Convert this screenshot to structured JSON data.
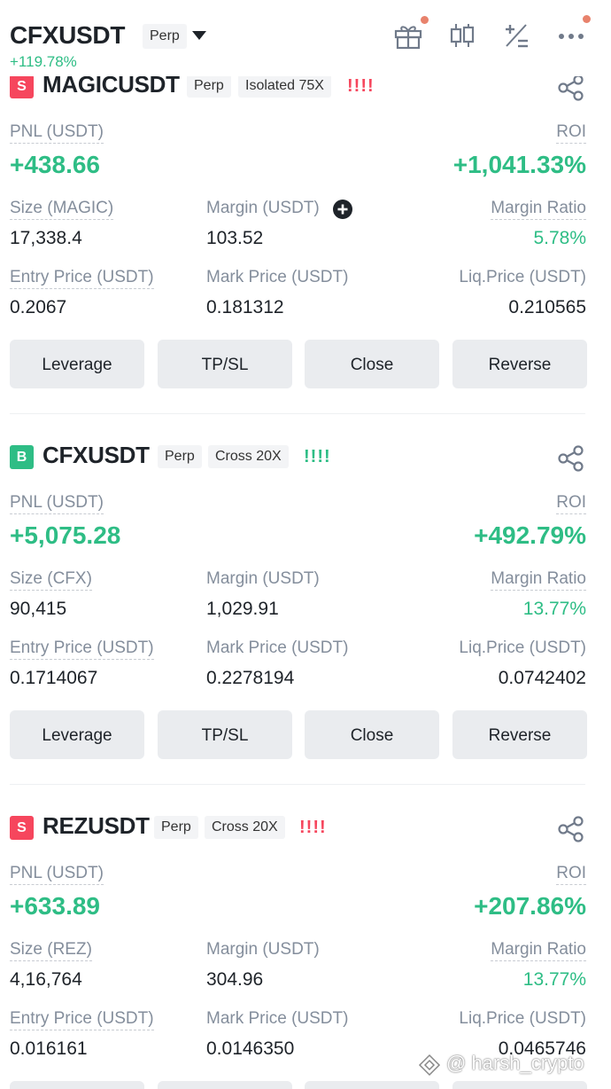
{
  "header": {
    "symbol": "CFXUSDT",
    "type": "Perp",
    "change": "+119.78%",
    "icons": [
      "gift-icon",
      "candlestick-icon",
      "calculator-icon",
      "more-icon"
    ]
  },
  "labels": {
    "pnl": "PNL (USDT)",
    "roi": "ROI",
    "margin": "Margin (USDT)",
    "margin_ratio": "Margin Ratio",
    "entry_price": "Entry Price (USDT)",
    "mark_price": "Mark Price (USDT)",
    "liq_price": "Liq.Price (USDT)"
  },
  "buttons": {
    "leverage": "Leverage",
    "tpsl": "TP/SL",
    "close": "Close",
    "reverse": "Reverse"
  },
  "positions": [
    {
      "side_letter": "S",
      "side": "short",
      "symbol": "MAGICUSDT",
      "type": "Perp",
      "margin_mode": "Isolated 75X",
      "risk_bars": "!!!!",
      "pnl": "+438.66",
      "roi": "+1,041.33%",
      "size_label": "Size (MAGIC)",
      "size": "17,338.4",
      "margin": "103.52",
      "margin_ratio": "5.78%",
      "entry_price": "0.2067",
      "mark_price": "0.181312",
      "liq_price": "0.210565"
    },
    {
      "side_letter": "B",
      "side": "long",
      "symbol": "CFXUSDT",
      "type": "Perp",
      "margin_mode": "Cross 20X",
      "risk_bars": "!!!!",
      "pnl": "+5,075.28",
      "roi": "+492.79%",
      "size_label": "Size (CFX)",
      "size": "90,415",
      "margin": "1,029.91",
      "margin_ratio": "13.77%",
      "entry_price": "0.1714067",
      "mark_price": "0.2278194",
      "liq_price": "0.0742402"
    },
    {
      "side_letter": "S",
      "side": "short",
      "symbol": "REZUSDT",
      "type": "Perp",
      "margin_mode": "Cross 20X",
      "risk_bars": "!!!!",
      "pnl": "+633.89",
      "roi": "+207.86%",
      "size_label": "Size (REZ)",
      "size": "4,16,764",
      "margin": "304.96",
      "margin_ratio": "13.77%",
      "entry_price": "0.016161",
      "mark_price": "0.0146350",
      "liq_price": "0.0465746"
    }
  ],
  "watermark": "@ harsh_crypto",
  "colors": {
    "profit": "#2ebd85",
    "short": "#f6465d",
    "button_bg": "#eaecef",
    "label": "#848e9c"
  }
}
